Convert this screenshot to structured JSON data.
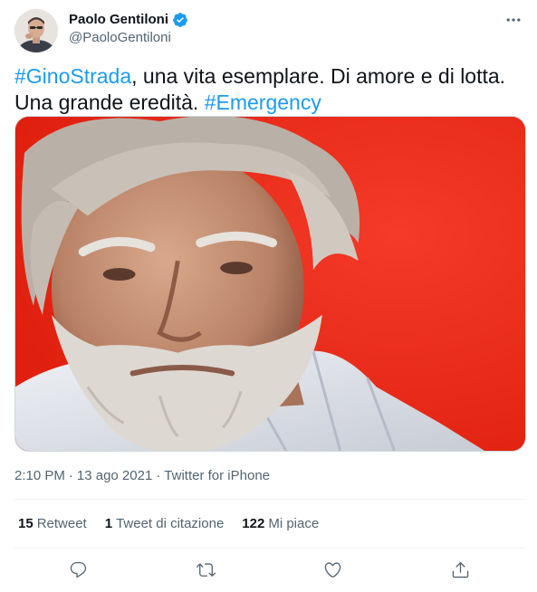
{
  "author": {
    "name": "Paolo Gentiloni",
    "handle": "@PaoloGentiloni",
    "verified": true
  },
  "tweet": {
    "hashtag1": "#GinoStrada",
    "text_part1": ", una vita esemplare. Di amore e di lotta. Una grande eredità. ",
    "hashtag2": "#Emergency"
  },
  "meta": {
    "time": "2:10 PM",
    "separator1": "·",
    "date": "13 ago 2021",
    "separator2": "·",
    "source": "Twitter for iPhone"
  },
  "stats": {
    "retweets_count": "15",
    "retweets_label": "Retweet",
    "quotes_count": "1",
    "quotes_label": "Tweet di citazione",
    "likes_count": "122",
    "likes_label": "Mi piace"
  },
  "colors": {
    "accent": "#1d9bf0",
    "text": "#0f1419",
    "secondary": "#536471",
    "photo_background": "#ef2b1c"
  },
  "icons": {
    "more": "more-icon",
    "verified": "verified-badge-icon",
    "reply": "reply-icon",
    "retweet": "retweet-icon",
    "like": "heart-icon",
    "share": "share-icon"
  }
}
